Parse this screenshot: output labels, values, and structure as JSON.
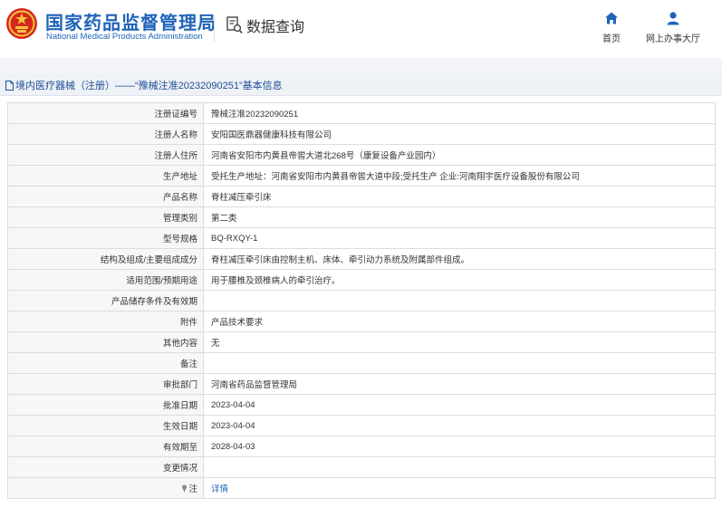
{
  "header": {
    "org_name_cn": "国家药品监督管理局",
    "org_name_en": "National Medical Products Administration",
    "data_query": "数据查询",
    "nav": {
      "home": "首页",
      "online_service": "网上办事大厅"
    }
  },
  "section": {
    "title": "境内医疗器械（注册）——“豫械注准20232090251”基本信息"
  },
  "rows": [
    {
      "label": "注册证编号",
      "value": "豫械注准20232090251"
    },
    {
      "label": "注册人名称",
      "value": "安阳国医鼎器健康科技有限公司"
    },
    {
      "label": "注册人住所",
      "value": "河南省安阳市内黄县帝喾大道北268号（康复设备产业园内）"
    },
    {
      "label": "生产地址",
      "value": "受托生产地址：河南省安阳市内黄县帝喾大道中段;受托生产 企业:河南翔宇医疗设备股份有限公司"
    },
    {
      "label": "产品名称",
      "value": "脊柱减压牵引床"
    },
    {
      "label": "管理类别",
      "value": "第二类"
    },
    {
      "label": "型号规格",
      "value": "BQ-RXQY-1"
    },
    {
      "label": "结构及组成/主要组成成分",
      "value": "脊柱减压牵引床由控制主机、床体、牵引动力系统及附属部件组成。"
    },
    {
      "label": "适用范围/预期用途",
      "value": "用于腰椎及颈椎病人的牵引治疗。"
    },
    {
      "label": "产品储存条件及有效期",
      "value": ""
    },
    {
      "label": "附件",
      "value": "产品技术要求"
    },
    {
      "label": "其他内容",
      "value": "无"
    },
    {
      "label": "备注",
      "value": ""
    },
    {
      "label": "审批部门",
      "value": "河南省药品监督管理局"
    },
    {
      "label": "批准日期",
      "value": "2023-04-04"
    },
    {
      "label": "生效日期",
      "value": "2023-04-04"
    },
    {
      "label": "有效期至",
      "value": "2028-04-03"
    },
    {
      "label": "变更情况",
      "value": ""
    }
  ],
  "note_row": {
    "label": "注",
    "link": "详情"
  },
  "colors": {
    "brand_blue": "#1f63b8",
    "emblem_red": "#d7261e",
    "emblem_gold": "#f3c33c"
  },
  "icons": [
    "national-emblem-icon",
    "doc-search-icon",
    "home-icon",
    "user-icon",
    "document-icon",
    "pin-icon"
  ]
}
